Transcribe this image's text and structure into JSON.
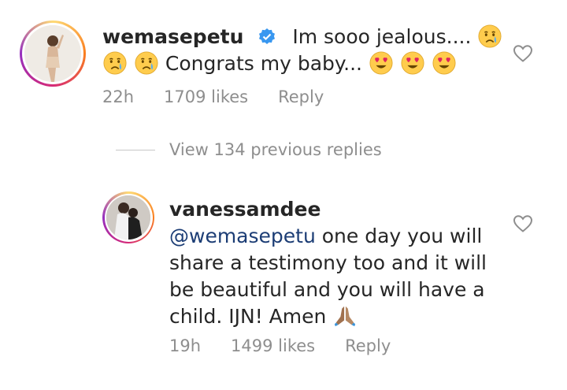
{
  "comments": [
    {
      "username": "wemasepetu",
      "verified": true,
      "text_line1": "Im sooo jealous....",
      "text_line2": "Congrats my baby...",
      "time": "22h",
      "likes": "1709 likes",
      "reply": "Reply",
      "emoji_crying": "crying-face-emoji",
      "emoji_hearts": "heart-eyes-emoji"
    },
    {
      "username": "vanessamdee",
      "mention": "@wemasepetu",
      "text_line1": "one day you will",
      "text_line2": "share a testimony too and it will",
      "text_line3": "be beautiful and you will have a",
      "text_line4": "child. IJN! Amen",
      "time": "19h",
      "likes": "1499 likes",
      "reply": "Reply",
      "emoji_pray": "folded-hands-emoji"
    }
  ],
  "view_replies": "View 134 previous replies",
  "colors": {
    "text": "#262626",
    "meta": "#8e8e8e",
    "mention": "#1c3d75",
    "verified": "#3897f0"
  }
}
